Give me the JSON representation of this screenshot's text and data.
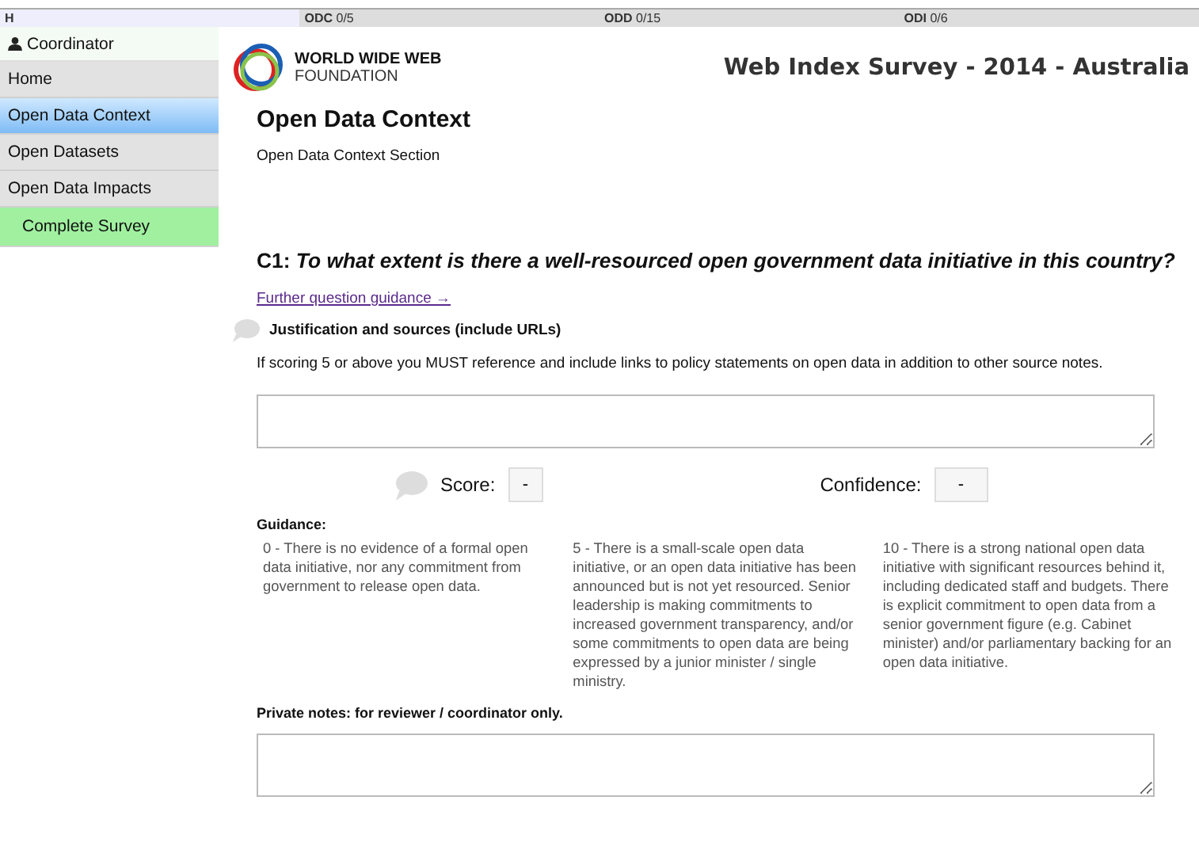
{
  "top_bar": {
    "tabs": [
      {
        "label": "H",
        "selected": true
      },
      {
        "label": "ODC",
        "count": "0/5",
        "selected": false
      },
      {
        "label": "ODD",
        "count": "0/15",
        "selected": false
      },
      {
        "label": "ODI",
        "count": "0/6",
        "selected": false
      }
    ]
  },
  "sidebar": {
    "user": "Coordinator",
    "items": [
      {
        "label": "Home",
        "kind": "link",
        "selected": false
      },
      {
        "label": "Open Data Context",
        "kind": "link",
        "selected": true
      },
      {
        "label": "Open Datasets",
        "kind": "link",
        "selected": false
      },
      {
        "label": "Open Data Impacts",
        "kind": "link",
        "selected": false
      },
      {
        "label": "Complete Survey",
        "kind": "action",
        "selected": false
      }
    ]
  },
  "header": {
    "logo_line1": "WORLD WIDE WEB",
    "logo_line2": "FOUNDATION",
    "title": "Web Index Survey - 2014 - Australia"
  },
  "section": {
    "title": "Open Data Context",
    "subtitle": "Open Data Context Section"
  },
  "question": {
    "text": "C1: *To what extent is there a well-resourced open government data initiative in this country?*",
    "guidance_link": "Further question guidance →",
    "justification_label": "Justification and sources (include URLs)",
    "justification_help": "If scoring 5 or above you MUST reference and include links to policy statements on open data in addition to other source notes.",
    "score_label": "Score:",
    "score_value": "-",
    "confidence_label": "Confidence:",
    "confidence_value": "-",
    "guidance_title": "Guidance:",
    "guidance": [
      "0 - There is no evidence of a formal open data initiative, nor any commitment from government to release open data.",
      "5 - There is a small-scale open data initiative, or an open data initiative has been announced but is not yet resourced. Senior leadership is making commitments to increased government transparency, and/or some commitments to open data are being expressed by a junior minister / single ministry.",
      "10 - There is a strong national open data initiative with significant resources behind it, including dedicated staff and budgets. There is explicit commitment to open data from a senior government figure (e.g. Cabinet minister) and/or parliamentary backing for an open data initiative."
    ],
    "private_notes_label": "Private notes: for reviewer / coordinator only."
  }
}
